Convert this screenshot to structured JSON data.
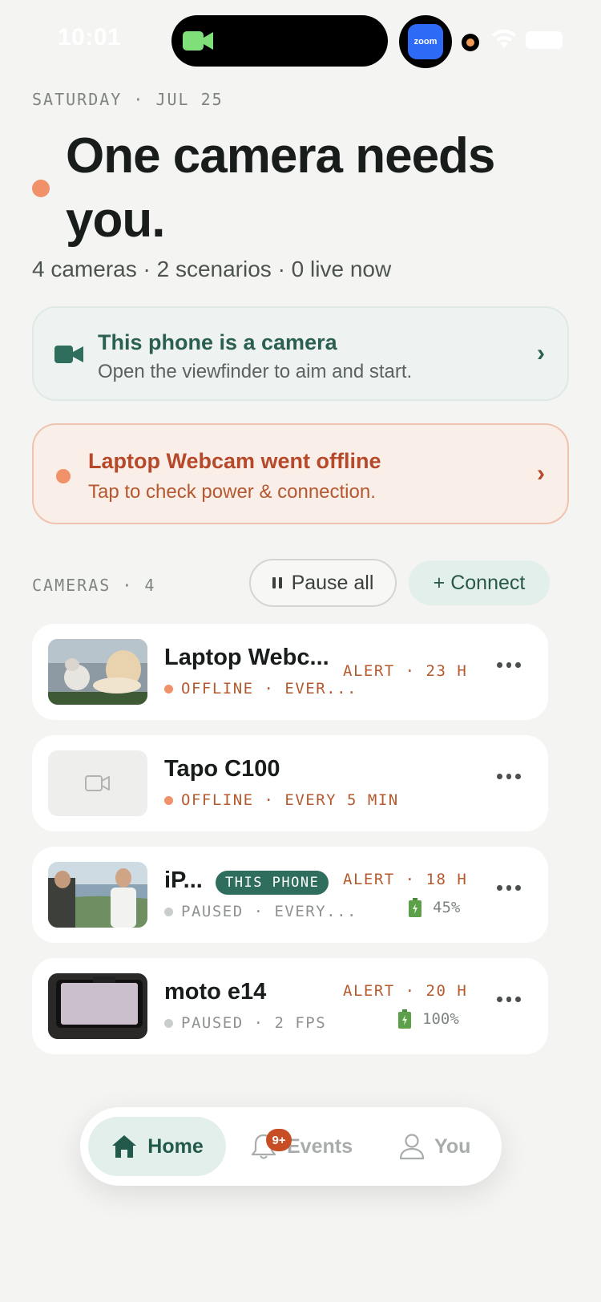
{
  "status_bar": {
    "time": "10:01",
    "zoom_app_label": "zoom"
  },
  "header": {
    "date": "SATURDAY · JUL 25",
    "headline": "One camera needs you.",
    "summary": "4 cameras · 2 scenarios · 0 live now"
  },
  "phone_camera_card": {
    "title": "This phone is a camera",
    "subtitle": "Open the viewfinder to aim and start.",
    "chevron": "›"
  },
  "offline_card": {
    "title": "Laptop Webcam went offline",
    "subtitle": "Tap to check power & connection.",
    "chevron": "›"
  },
  "cameras_section": {
    "label": "CAMERAS · 4",
    "pause_all_label": "Pause all",
    "connect_label": "+ Connect"
  },
  "cameras": [
    {
      "name": "Laptop Webc...",
      "status": "OFFLINE · EVER...",
      "state": "offline",
      "alert": "ALERT · 23 H"
    },
    {
      "name": "Tapo C100",
      "status": "OFFLINE · EVERY 5 MIN",
      "state": "offline"
    },
    {
      "name": "iP...",
      "badge": "THIS PHONE",
      "status": "PAUSED · EVERY...",
      "state": "paused",
      "alert": "ALERT · 18 H",
      "battery": "45%"
    },
    {
      "name": "moto e14",
      "status": "PAUSED · 2 FPS",
      "state": "paused",
      "alert": "ALERT · 20 H",
      "battery": "100%"
    }
  ],
  "tab_bar": {
    "home_label": "Home",
    "events_label": "Events",
    "events_badge": "9+",
    "you_label": "You"
  },
  "colors": {
    "accent_green": "#2f6e5d",
    "alert_orange": "#f0916a",
    "alert_text": "#b45a2e",
    "paused_gray": "#c9cdcb"
  }
}
